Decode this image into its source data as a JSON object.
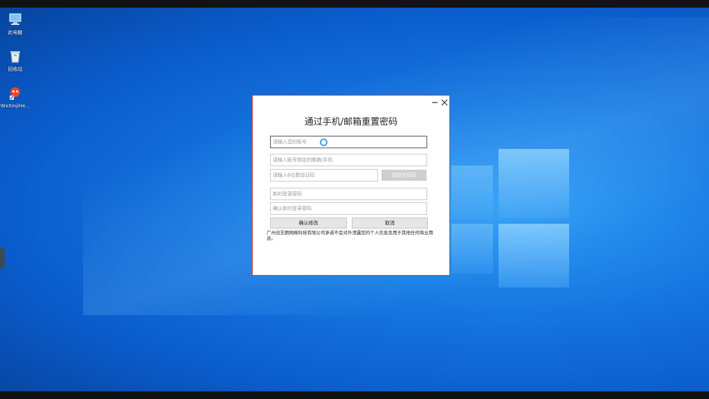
{
  "desktop": {
    "icons": [
      {
        "label": "此电脑",
        "icon": "computer-icon"
      },
      {
        "label": "回收站",
        "icon": "recycle-bin-icon"
      },
      {
        "label": "WxXinjiHe...",
        "icon": "app-shortcut-icon"
      }
    ]
  },
  "dialog": {
    "title": "通过手机/邮箱重置密码",
    "minimize_icon": "minimize-icon",
    "close_icon": "close-icon",
    "fields": {
      "account_placeholder": "请输入您的账号",
      "bound_contact_placeholder": "请输入账号绑定的邮箱/手机",
      "code_placeholder": "请输入6位数验证码",
      "new_password_placeholder": "新的登录密码",
      "confirm_password_placeholder": "确认新的登录密码"
    },
    "get_code_label": "获取验证码",
    "confirm_label": "确认修改",
    "cancel_label": "取消",
    "notice": "广州迅艺朗网络科技有限公司承诺不会对外泄露您的个人信息及用于其他任何商业用途。",
    "accent_color": "#d33a3a",
    "loading_icon": "loading-spinner-icon"
  }
}
